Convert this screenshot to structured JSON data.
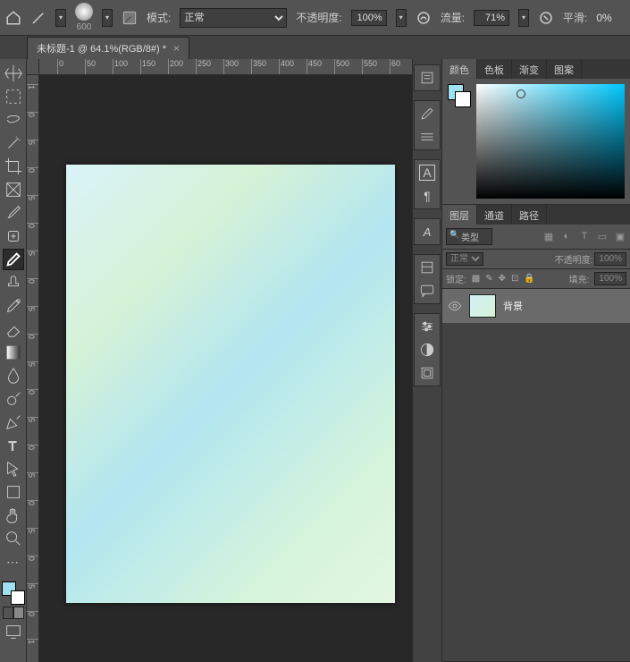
{
  "optbar": {
    "brush_size": "600",
    "mode_label": "模式:",
    "mode_value": "正常",
    "opacity_label": "不透明度:",
    "opacity_value": "100%",
    "flow_label": "流量:",
    "flow_value": "71%",
    "smooth_label": "平滑:",
    "smooth_value": "0%"
  },
  "doc": {
    "tab_title": "未标题-1 @ 64.1%(RGB/8#) *"
  },
  "ruler": {
    "h_ticks": [
      "0",
      "50",
      "100",
      "150",
      "200",
      "250",
      "300",
      "350",
      "400",
      "450",
      "500",
      "550",
      "60"
    ],
    "v_ticks": [
      "1",
      "0",
      "5",
      "0",
      "5",
      "0",
      "5",
      "0",
      "5",
      "0",
      "5",
      "0",
      "5",
      "0",
      "5",
      "0",
      "5",
      "0",
      "5",
      "0",
      "1"
    ]
  },
  "color_panel": {
    "tabs": [
      "颜色",
      "色板",
      "渐变",
      "图案"
    ]
  },
  "layers_panel": {
    "tabs": [
      "图层",
      "通道",
      "路径"
    ],
    "type_filter": "类型",
    "blend_mode": "正常",
    "opacity_label": "不透明度:",
    "opacity_value": "100%",
    "lock_label": "锁定:",
    "fill_label": "填充:",
    "fill_value": "100%",
    "layer_name": "背景"
  },
  "swatch": {
    "fg_color": "#9fe1f1",
    "bg_color": "#ffffff"
  }
}
